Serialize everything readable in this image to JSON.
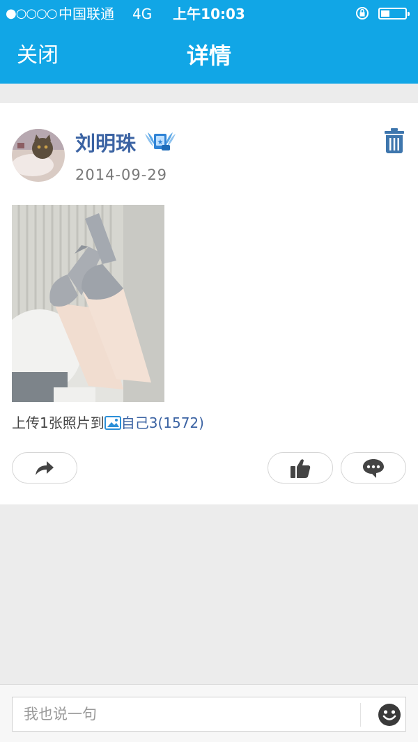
{
  "status": {
    "signal": "●○○○○",
    "carrier": "中国联通",
    "network": "4G",
    "time": "上午10:03",
    "battery_level": 0.35
  },
  "nav": {
    "close_label": "关闭",
    "title": "详情"
  },
  "post": {
    "username": "刘明珠",
    "badge_icon": "vip-wing-badge-icon",
    "date": "2014-09-29",
    "upload_prefix": "上传1张照片到",
    "album_name": "自己3(1572)"
  },
  "actions": {
    "share_icon": "share-arrow-icon",
    "like_icon": "thumbs-up-icon",
    "comment_icon": "speech-bubble-icon"
  },
  "comment_bar": {
    "placeholder": "我也说一句",
    "emoji_icon": "smiley-icon"
  },
  "colors": {
    "accent": "#11a6e6",
    "username": "#3b63a3",
    "background": "#ececec"
  }
}
